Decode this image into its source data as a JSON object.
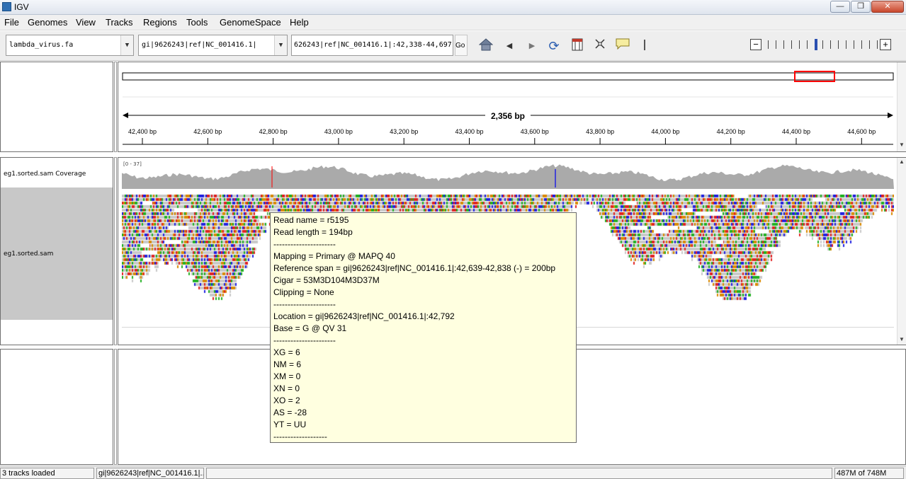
{
  "window": {
    "title": "IGV",
    "minimize": "—",
    "restore": "❐",
    "close": "✕"
  },
  "menu": [
    "File",
    "Genomes",
    "View",
    "Tracks",
    "Regions",
    "Tools",
    "GenomeSpace",
    "Help"
  ],
  "toolbar": {
    "genome": "lambda_virus.fa",
    "chromosome": "gi|9626243|ref|NC_001416.1|",
    "locus": "626243|ref|NC_001416.1|:42,338-44,697",
    "go_label": "Go",
    "icons": [
      "home-icon",
      "back-icon",
      "forward-icon",
      "refresh-icon",
      "region-icon",
      "fit-icon",
      "popup-icon"
    ],
    "zoom_out": "−",
    "zoom_in": "+"
  },
  "ruler": {
    "span_label": "2,356 bp",
    "ticks": [
      "42,400 bp",
      "42,600 bp",
      "42,800 bp",
      "43,000 bp",
      "43,200 bp",
      "43,400 bp",
      "43,600 bp",
      "43,800 bp",
      "44,000 bp",
      "44,200 bp",
      "44,400 bp",
      "44,600 bp"
    ]
  },
  "tracks": {
    "coverage_name": "eg1.sorted.sam Coverage",
    "coverage_range": "[0 - 37]",
    "alignment_name": "eg1.sorted.sam"
  },
  "tooltip": {
    "lines": [
      "Read name = r5195",
      "Read length = 194bp",
      "----------------------",
      "Mapping = Primary @ MAPQ 40",
      "Reference span = gi|9626243|ref|NC_001416.1|:42,639-42,838 (-) = 200bp",
      "Cigar = 53M3D104M3D37M",
      "Clipping = None",
      "----------------------",
      "Location = gi|9626243|ref|NC_001416.1|:42,792",
      "Base = G @ QV 31",
      "----------------------",
      "XG = 6",
      "NM = 6",
      "XM = 0",
      "XN = 0",
      "XO = 2",
      "AS = -28",
      "YT = UU",
      "-------------------"
    ]
  },
  "status": {
    "tracks_loaded": "3 tracks loaded",
    "position": "gi|9626243|ref|NC_001416.1|...",
    "memory": "487M of 748M"
  },
  "colors": {
    "A": "#22b022",
    "C": "#2222e0",
    "G": "#d98a00",
    "T": "#e02222",
    "gray": "#c8c8c8",
    "coverage": "#aaaaaa",
    "region": "#ff0000"
  }
}
